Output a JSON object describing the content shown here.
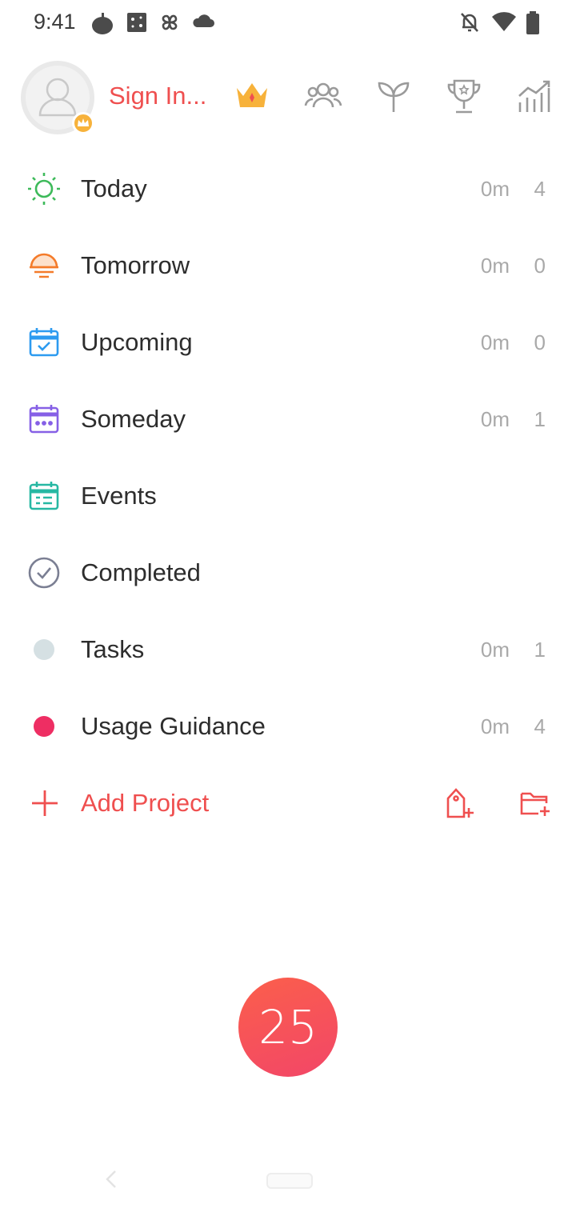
{
  "status_bar": {
    "time": "9:41"
  },
  "header": {
    "sign_in_label": "Sign In..."
  },
  "menu": [
    {
      "label": "Today",
      "time": "0m",
      "count": "4",
      "icon": "sun-icon",
      "color": "#3dba5a"
    },
    {
      "label": "Tomorrow",
      "time": "0m",
      "count": "0",
      "icon": "sunset-icon",
      "color": "#f47b2a"
    },
    {
      "label": "Upcoming",
      "time": "0m",
      "count": "0",
      "icon": "calendar-check-icon",
      "color": "#2d9bf0"
    },
    {
      "label": "Someday",
      "time": "0m",
      "count": "1",
      "icon": "calendar-dots-icon",
      "color": "#8660e6"
    },
    {
      "label": "Events",
      "icon": "calendar-list-icon",
      "color": "#27b8a3"
    },
    {
      "label": "Completed",
      "icon": "check-circle-icon",
      "color": "#7b7f93"
    },
    {
      "label": "Tasks",
      "time": "0m",
      "count": "1",
      "icon": "dot-icon",
      "color": "#d5e0e3"
    },
    {
      "label": "Usage Guidance",
      "time": "0m",
      "count": "4",
      "icon": "dot-icon",
      "color": "#ee2e63"
    }
  ],
  "add_project": {
    "label": "Add Project"
  },
  "pomodoro": {
    "value": "25"
  },
  "colors": {
    "accent": "#ef4f4f",
    "crown": "#f7b23b"
  }
}
